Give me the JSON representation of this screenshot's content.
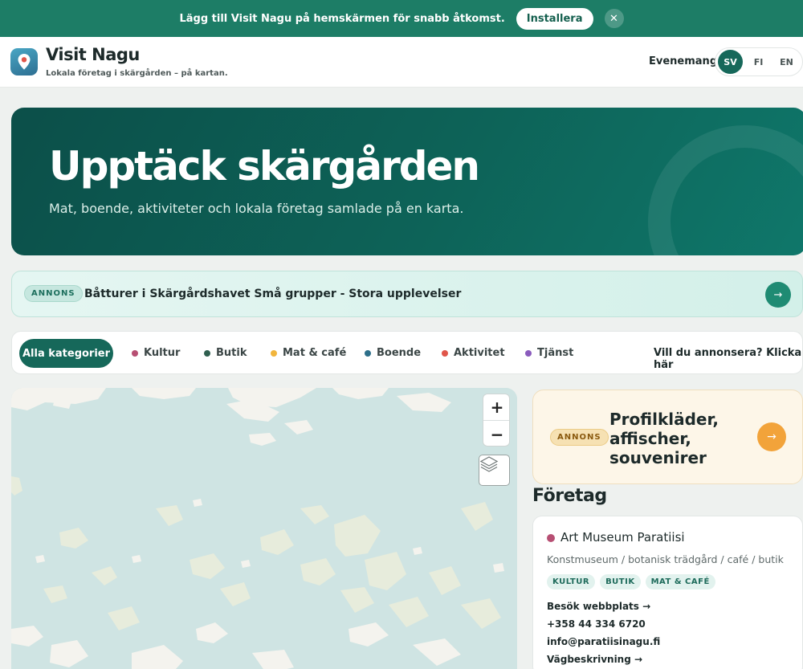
{
  "banner": {
    "text": "Lägg till Visit Nagu på hemskärmen för snabb åtkomst.",
    "install_label": "Installera",
    "close_glyph": "✕"
  },
  "header": {
    "title": "Visit Nagu",
    "subtitle": "Lokala företag i skärgården – på kartan.",
    "events_label": "Evenemang",
    "languages": [
      "SV",
      "FI",
      "EN"
    ],
    "active_language": "SV"
  },
  "hero": {
    "title": "Upptäck skärgården",
    "subtitle": "Mat, boende, aktiviteter och lokala företag samlade på en karta."
  },
  "ad_bar": {
    "badge": "ANNONS",
    "text": "Båtturer i Skärgårdshavet Små grupper - Stora upplevelser",
    "arrow": "→"
  },
  "categories": {
    "all_label": "Alla kategorier",
    "items": [
      {
        "label": "Kultur",
        "color": "#b74f73"
      },
      {
        "label": "Butik",
        "color": "#2f5f4f"
      },
      {
        "label": "Mat & café",
        "color": "#f1b53c"
      },
      {
        "label": "Boende",
        "color": "#2d6f8a"
      },
      {
        "label": "Aktivitet",
        "color": "#e0564a"
      },
      {
        "label": "Tjänst",
        "color": "#8a5bbd"
      }
    ],
    "cta": "Vill du annonsera? Klicka här"
  },
  "map": {
    "zoom_in": "+",
    "zoom_out": "−"
  },
  "side_ad": {
    "badge": "ANNONS",
    "text": "Profilkläder, affischer, souvenirer",
    "arrow": "→"
  },
  "list": {
    "title": "Företag",
    "businesses": [
      {
        "name": "Art Museum Paratiisi",
        "description": "Konstmuseum / botanisk trädgård / café / butik",
        "tags": [
          "KULTUR",
          "BUTIK",
          "MAT & CAFÉ"
        ],
        "website_label": "Besök webbplats →",
        "phone": "+358 44 334 6720",
        "email": "info@paratiisinagu.fi",
        "directions_label": "Vägbeskrivning →",
        "category_color": "#b74f73"
      }
    ]
  }
}
